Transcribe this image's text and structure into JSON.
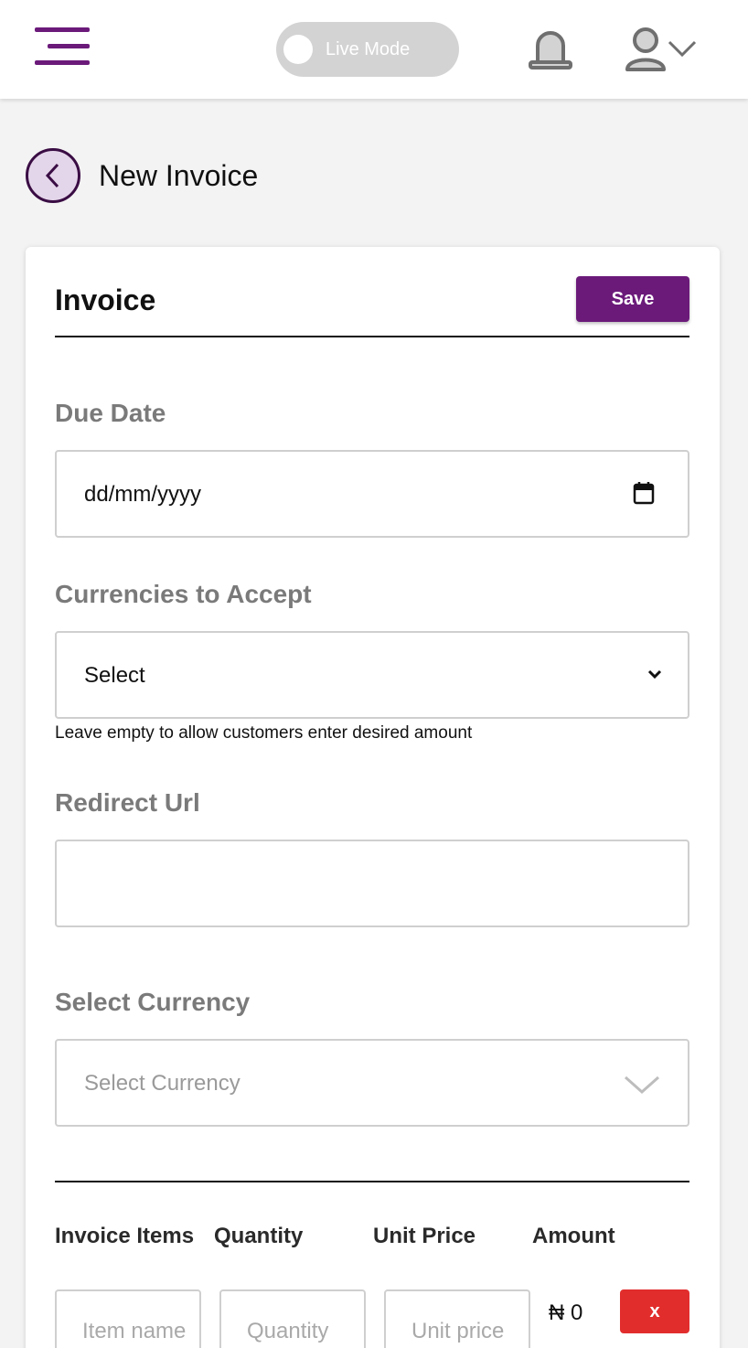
{
  "header": {
    "live_mode_label": "Live Mode"
  },
  "page": {
    "title": "New Invoice"
  },
  "card": {
    "title": "Invoice",
    "save_label": "Save"
  },
  "form": {
    "due_date": {
      "label": "Due Date",
      "placeholder": "dd/mm/yyyy"
    },
    "currencies_to_accept": {
      "label": "Currencies to Accept",
      "value": "Select",
      "helper": "Leave empty to allow customers enter desired amount"
    },
    "redirect_url": {
      "label": "Redirect Url",
      "value": ""
    },
    "select_currency": {
      "label": "Select Currency",
      "placeholder": "Select Currency"
    }
  },
  "items_table": {
    "columns": [
      "Invoice Items",
      "Quantity",
      "Unit Price",
      "Amount"
    ],
    "row": {
      "item_placeholder": "Item name",
      "quantity_placeholder": "Quantity",
      "unit_price_placeholder": "Unit price",
      "amount": "₦ 0",
      "remove_label": "x"
    }
  },
  "colors": {
    "brand": "#6b1a7a",
    "danger": "#e22d2d",
    "toggle_off": "#d3d3d3"
  },
  "icons": [
    "menu-icon",
    "bell-icon",
    "user-icon",
    "chevron-down-icon",
    "chevron-left-icon",
    "calendar-icon"
  ]
}
